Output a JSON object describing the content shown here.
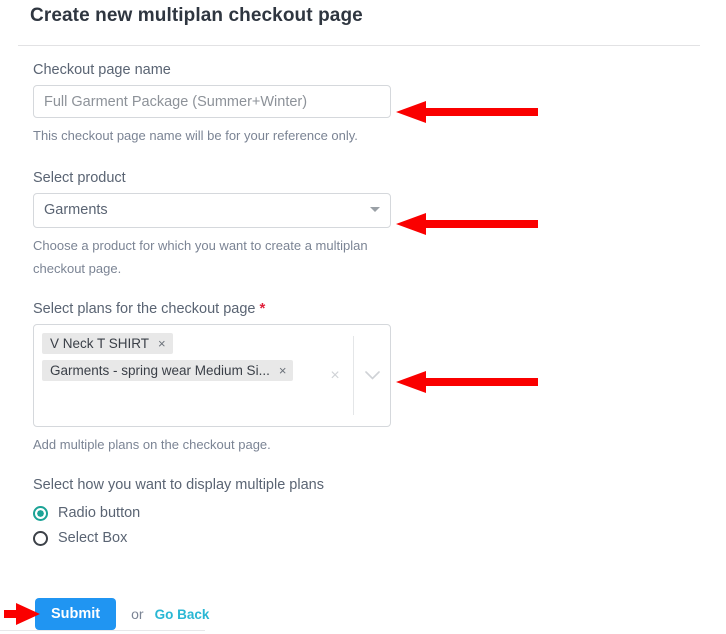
{
  "page": {
    "title": "Create new multiplan checkout page"
  },
  "fields": {
    "checkout_name": {
      "label": "Checkout page name",
      "value": "Full Garment Package (Summer+Winter)",
      "placeholder": "Full Garment Package (Summer+Winter)",
      "helper": "This checkout page name will be for your reference only."
    },
    "product": {
      "label": "Select product",
      "selected": "Garments",
      "helper": "Choose a product for which you want to create a multiplan checkout page."
    },
    "plans": {
      "label": "Select plans for the checkout page",
      "required_marker": "*",
      "chips": [
        {
          "label": "V Neck T SHIRT",
          "remove": "×"
        },
        {
          "label": "Garments - spring wear Medium Si...",
          "remove": "×"
        }
      ],
      "clear_all": "×",
      "helper": "Add multiple plans on the checkout page."
    },
    "display_mode": {
      "label": "Select how you want to display multiple plans",
      "options": [
        {
          "label": "Radio button",
          "selected": true
        },
        {
          "label": "Select Box",
          "selected": false
        }
      ]
    }
  },
  "footer": {
    "submit_label": "Submit",
    "or_text": "or",
    "go_back_label": "Go Back"
  },
  "colors": {
    "submit_blue": "#2095f2",
    "link_teal": "#2ab7d4",
    "radio_teal": "#1ba396",
    "required_red": "#e0203b",
    "annotation_red": "#fa0000"
  },
  "annotations": [
    {
      "name": "arrow-to-checkout-name-input",
      "direction": "left"
    },
    {
      "name": "arrow-to-product-select",
      "direction": "left"
    },
    {
      "name": "arrow-to-plans-multiselect",
      "direction": "left"
    },
    {
      "name": "arrow-to-submit-button",
      "direction": "right"
    }
  ]
}
